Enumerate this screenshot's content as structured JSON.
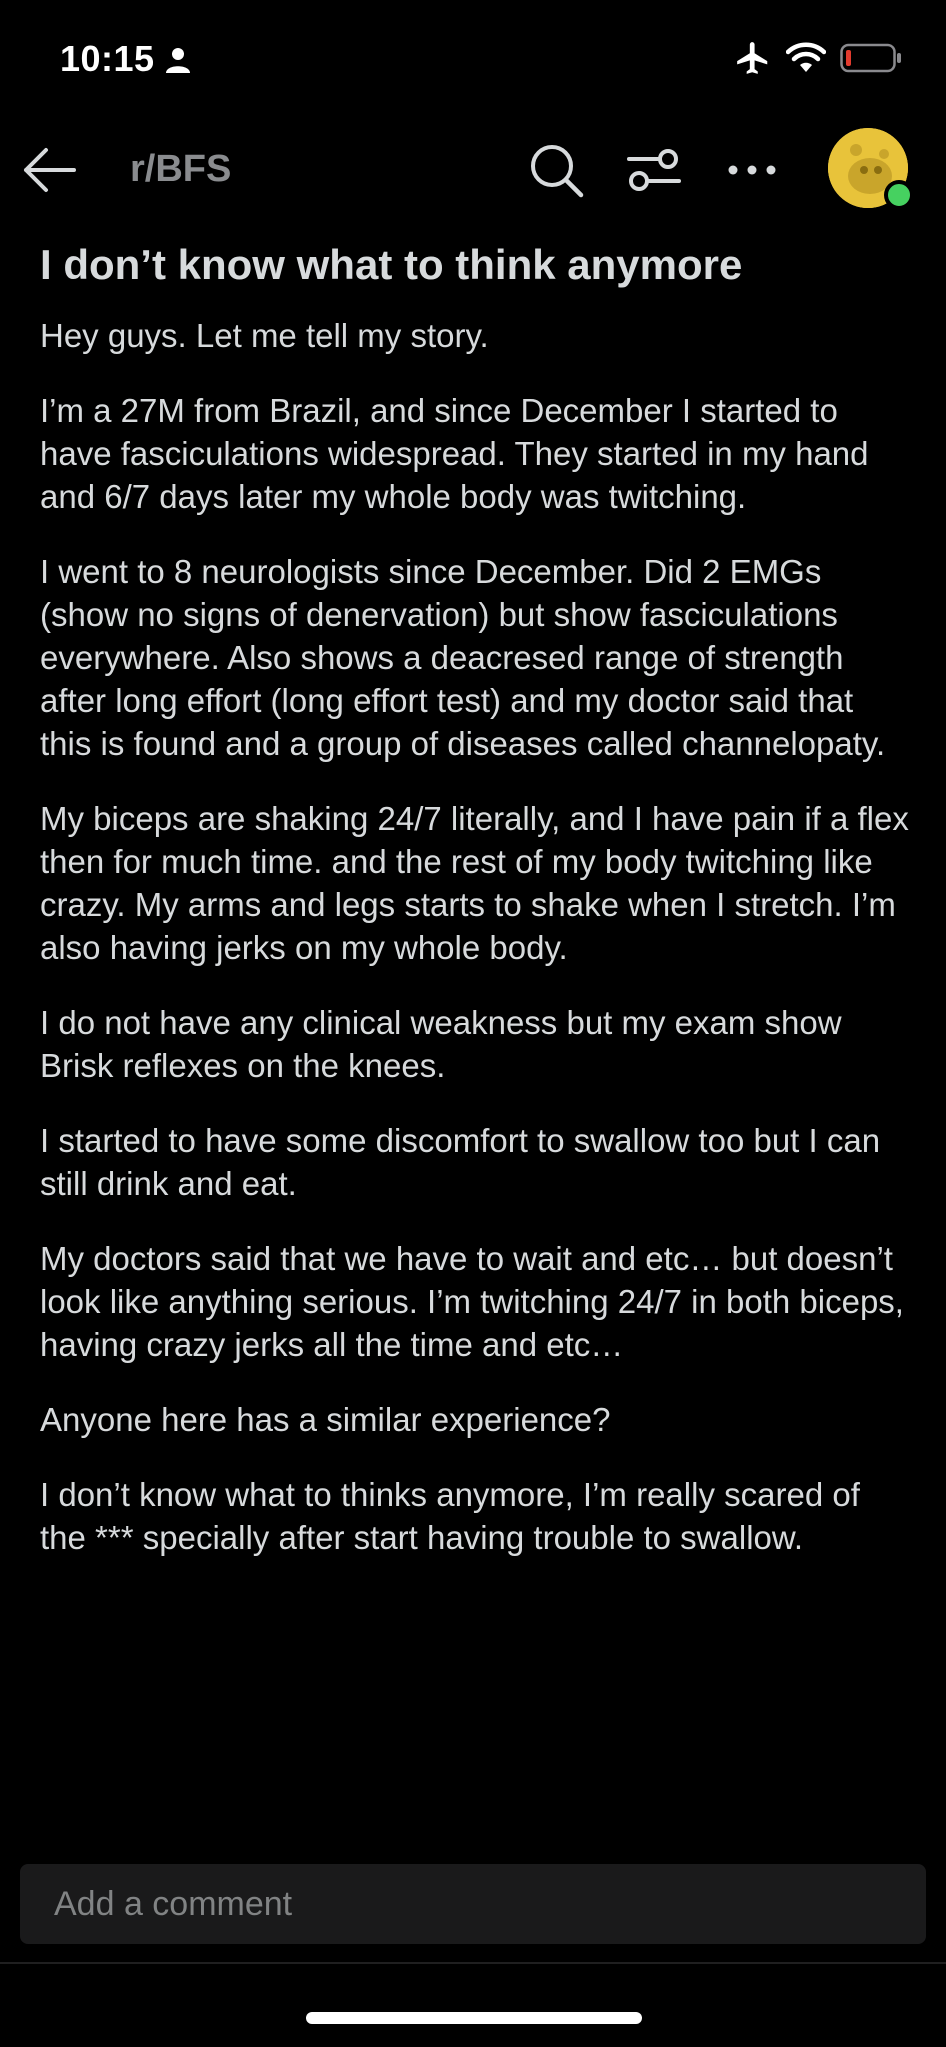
{
  "status_bar": {
    "time": "10:15",
    "icons": [
      "person-icon",
      "airplane-icon",
      "wifi-icon",
      "battery-icon"
    ],
    "battery_level_color": "#e23b2e"
  },
  "nav": {
    "subreddit": "r/BFS",
    "icons": [
      "back-arrow-icon",
      "search-icon",
      "filter-icon",
      "more-icon"
    ],
    "avatar_color": "#e8c33a",
    "online_color": "#46d160"
  },
  "post": {
    "title": "I don’t know what to think anymore",
    "paragraphs": [
      "Hey guys. Let me tell my story.",
      "I’m a 27M from Brazil, and since December I started to have fasciculations widespread. They started in my hand and 6/7 days later my whole body was twitching.",
      "I went to 8 neurologists since December. Did 2 EMGs (show no signs of denervation) but show fasciculations everywhere. Also shows a deacresed range of strength after long effort (long effort test) and my doctor said that this is found and a group of diseases called channelopaty.",
      "My biceps are shaking 24/7 literally, and I have pain if a flex then for much time. and the rest of my body twitching like crazy. My arms and legs starts to shake when I stretch. I’m also having jerks on my whole body.",
      "I do not have any clinical weakness but my exam show Brisk reflexes on the knees.",
      "I started to have some discomfort to swallow too but I can still drink and eat.",
      "My doctors said that we have to wait and etc… but doesn’t look like anything serious. I’m twitching 24/7 in both biceps, having crazy jerks all the time and etc…",
      "Anyone here has a similar experience?",
      "I don’t know what to thinks anymore, I’m really scared of the *** specially after start having trouble to swallow."
    ]
  },
  "comment": {
    "placeholder": "Add a comment"
  }
}
